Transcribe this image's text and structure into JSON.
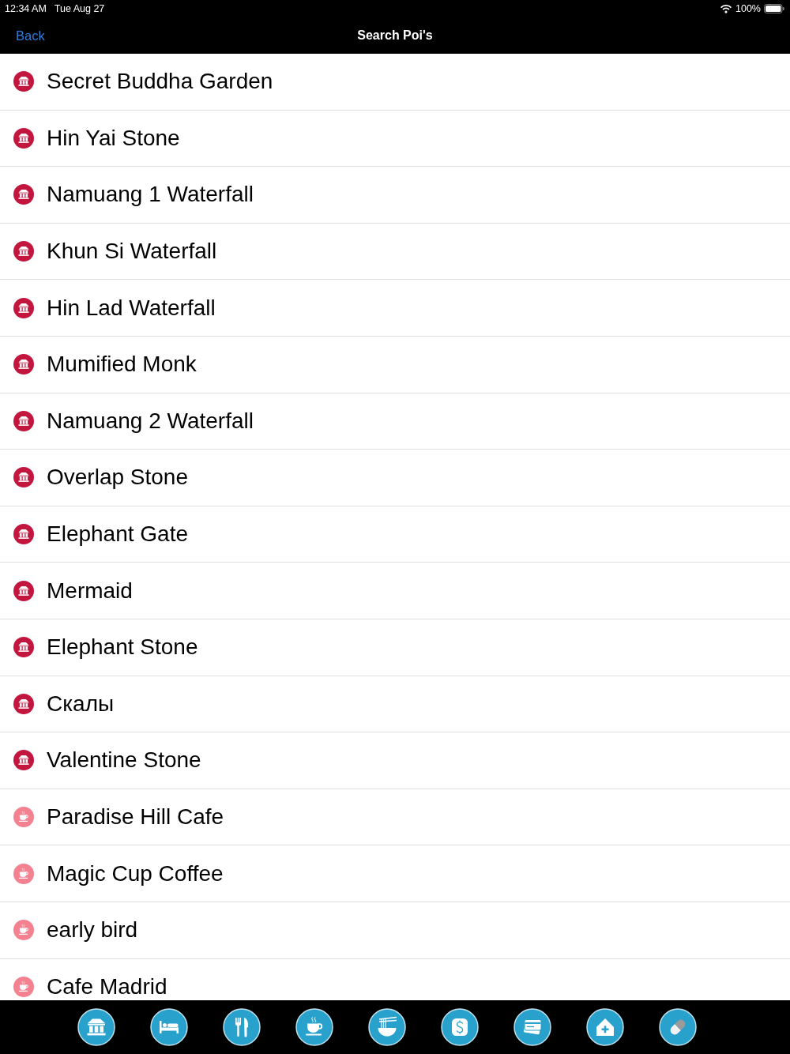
{
  "status_bar": {
    "time": "12:34 AM",
    "date": "Tue Aug 27",
    "battery": "100%"
  },
  "nav_bar": {
    "back": "Back",
    "title": "Search Poi's"
  },
  "poi_list": [
    {
      "name": "Secret Buddha Garden",
      "kind": "attraction"
    },
    {
      "name": "Hin Yai Stone",
      "kind": "attraction"
    },
    {
      "name": "Namuang 1 Waterfall",
      "kind": "attraction"
    },
    {
      "name": "Khun Si Waterfall",
      "kind": "attraction"
    },
    {
      "name": "Hin Lad Waterfall",
      "kind": "attraction"
    },
    {
      "name": "Mumified Monk",
      "kind": "attraction"
    },
    {
      "name": "Namuang 2 Waterfall",
      "kind": "attraction"
    },
    {
      "name": "Overlap Stone",
      "kind": "attraction"
    },
    {
      "name": "Elephant Gate",
      "kind": "attraction"
    },
    {
      "name": "Mermaid",
      "kind": "attraction"
    },
    {
      "name": "Elephant Stone",
      "kind": "attraction"
    },
    {
      "name": "Скалы",
      "kind": "attraction"
    },
    {
      "name": "Valentine Stone",
      "kind": "attraction"
    },
    {
      "name": "Paradise Hill Cafe",
      "kind": "cafe"
    },
    {
      "name": "Magic Cup Coffee",
      "kind": "cafe"
    },
    {
      "name": "early bird",
      "kind": "cafe"
    },
    {
      "name": "Cafe Madrid",
      "kind": "cafe"
    }
  ],
  "tab_bar": [
    {
      "kind": "attraction"
    },
    {
      "kind": "hotel"
    },
    {
      "kind": "restaurant"
    },
    {
      "kind": "cafe"
    },
    {
      "kind": "noodles"
    },
    {
      "kind": "money"
    },
    {
      "kind": "card"
    },
    {
      "kind": "hospital"
    },
    {
      "kind": "pharmacy"
    }
  ]
}
